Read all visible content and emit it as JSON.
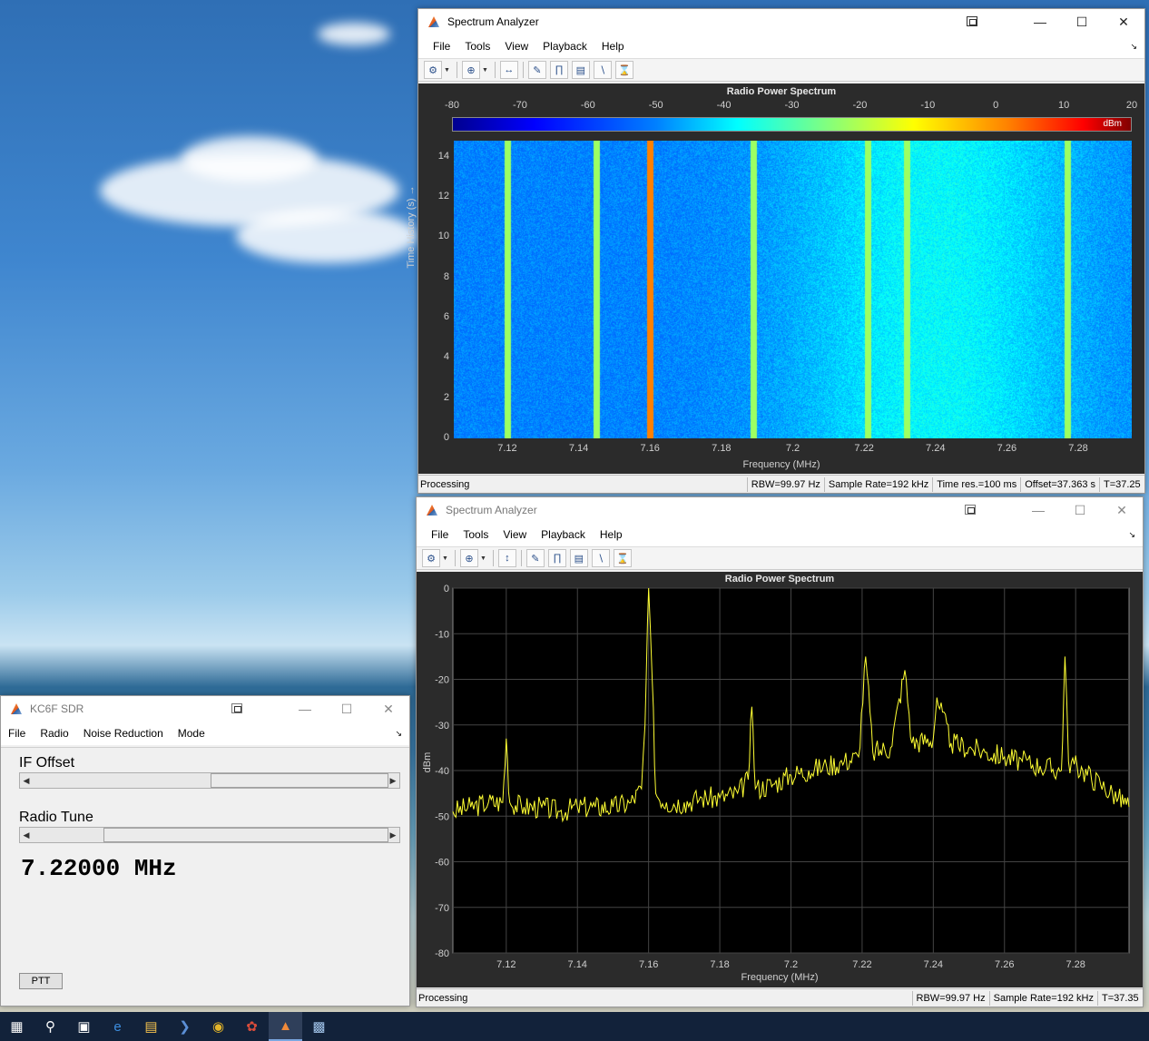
{
  "colors": {
    "trace": "#ffff33",
    "plot_bg": "#000000",
    "pane_bg": "#2b2b2b"
  },
  "taskbar": {
    "icons": [
      "windows-start-icon",
      "search-icon",
      "task-view-icon",
      "edge-icon",
      "file-explorer-icon",
      "powershell-icon",
      "chrome-icon",
      "app-icon",
      "matlab-icon",
      "remote-desktop-icon"
    ]
  },
  "top_window": {
    "title": "Spectrum Analyzer",
    "menu": [
      "File",
      "Tools",
      "View",
      "Playback",
      "Help"
    ],
    "plot_title": "Radio Power Spectrum",
    "colorbar_ticks": [
      "-80",
      "-70",
      "-60",
      "-50",
      "-40",
      "-30",
      "-20",
      "-10",
      "0",
      "10",
      "20"
    ],
    "colorbar_unit": "dBm",
    "y_label": "Time History (s) →",
    "y_ticks": [
      "14",
      "12",
      "10",
      "8",
      "6",
      "4",
      "2",
      "0"
    ],
    "x_ticks": [
      "7.12",
      "7.14",
      "7.16",
      "7.18",
      "7.2",
      "7.22",
      "7.24",
      "7.26",
      "7.28"
    ],
    "x_label": "Frequency (MHz)",
    "status": {
      "state": "Processing",
      "rbw": "RBW=99.97 Hz",
      "sample_rate": "Sample Rate=192 kHz",
      "time_res": "Time res.=100 ms",
      "offset": "Offset=37.363 s",
      "time": "T=37.25"
    }
  },
  "bottom_window": {
    "title": "Spectrum Analyzer",
    "menu": [
      "File",
      "Tools",
      "View",
      "Playback",
      "Help"
    ],
    "plot_title": "Radio Power Spectrum",
    "y_label": "dBm",
    "x_label": "Frequency (MHz)",
    "status": {
      "state": "Processing",
      "rbw": "RBW=99.97 Hz",
      "sample_rate": "Sample Rate=192 kHz",
      "time": "T=37.35"
    }
  },
  "chart_data": [
    {
      "type": "heatmap",
      "title": "Radio Power Spectrum",
      "xlabel": "Frequency (MHz)",
      "ylabel": "Time History (s)",
      "xlim": [
        7.105,
        7.295
      ],
      "ylim": [
        0,
        14.8
      ],
      "x_ticks": [
        7.12,
        7.14,
        7.16,
        7.18,
        7.2,
        7.22,
        7.24,
        7.26,
        7.28
      ],
      "y_ticks": [
        0,
        2,
        4,
        6,
        8,
        10,
        12,
        14
      ],
      "colorbar": {
        "label": "dBm",
        "range": [
          -80,
          20
        ]
      },
      "strong_lines_mhz": [
        7.12,
        7.145,
        7.16,
        7.189,
        7.221,
        7.232,
        7.277
      ]
    },
    {
      "type": "line",
      "title": "Radio Power Spectrum",
      "xlabel": "Frequency (MHz)",
      "ylabel": "dBm",
      "xlim": [
        7.105,
        7.295
      ],
      "ylim": [
        -80,
        0
      ],
      "x_ticks": [
        7.12,
        7.14,
        7.16,
        7.18,
        7.2,
        7.22,
        7.24,
        7.26,
        7.28
      ],
      "y_ticks": [
        0,
        -10,
        -20,
        -30,
        -40,
        -50,
        -60,
        -70,
        -80
      ],
      "grid": true,
      "series": [
        {
          "x": [
            7.105,
            7.11,
            7.115,
            7.119,
            7.12,
            7.121,
            7.125,
            7.13,
            7.135,
            7.14,
            7.145,
            7.15,
            7.155,
            7.158,
            7.159,
            7.16,
            7.161,
            7.162,
            7.165,
            7.17,
            7.175,
            7.18,
            7.185,
            7.188,
            7.189,
            7.19,
            7.195,
            7.2,
            7.205,
            7.21,
            7.215,
            7.219,
            7.221,
            7.223,
            7.228,
            7.232,
            7.234,
            7.24,
            7.241,
            7.245,
            7.25,
            7.255,
            7.26,
            7.265,
            7.27,
            7.276,
            7.277,
            7.278,
            7.282,
            7.287,
            7.292,
            7.295
          ],
          "values": [
            -49,
            -48,
            -47,
            -47,
            -33,
            -47,
            -48,
            -48,
            -49,
            -48,
            -48,
            -48,
            -47,
            -44,
            -30,
            0,
            -20,
            -45,
            -47,
            -47,
            -46,
            -46,
            -45,
            -42,
            -26,
            -44,
            -43,
            -41,
            -40,
            -39,
            -38,
            -37,
            -15,
            -36,
            -35,
            -18,
            -34,
            -33,
            -24,
            -34,
            -35,
            -36,
            -37,
            -38,
            -39,
            -40,
            -15,
            -38,
            -40,
            -43,
            -46,
            -48
          ]
        }
      ]
    }
  ],
  "sdr_window": {
    "title": "KC6F SDR",
    "menu": [
      "File",
      "Radio",
      "Noise Reduction",
      "Mode"
    ],
    "if_offset_label": "IF Offset",
    "radio_tune_label": "Radio Tune",
    "if_offset_value": 0.5,
    "radio_tune_value": 0.2,
    "frequency_readout": "7.22000 MHz",
    "ptt_label": "PTT"
  }
}
